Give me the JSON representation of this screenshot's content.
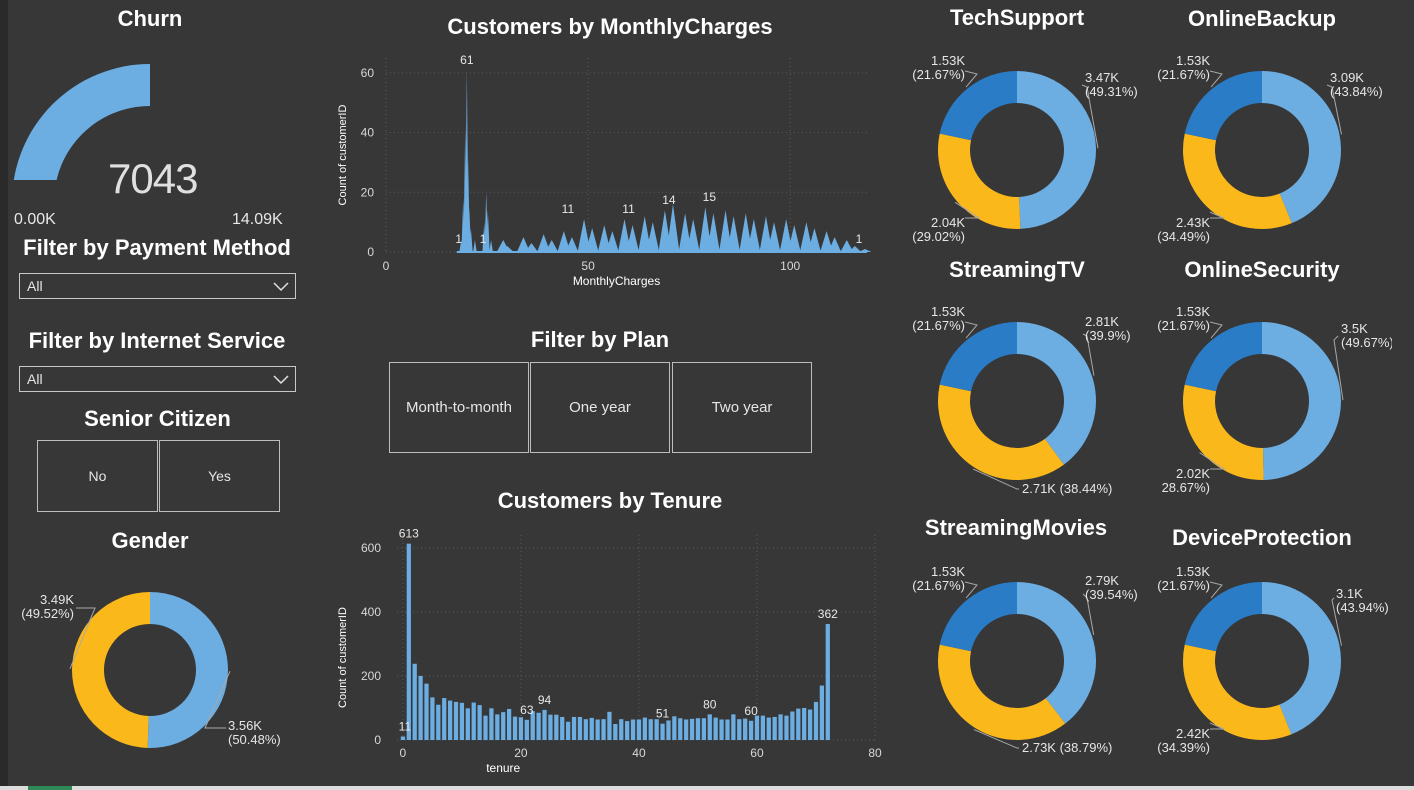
{
  "gauge": {
    "title": "Churn",
    "value_label": "7043",
    "value": 7043,
    "min_label": "0.00K",
    "max_label": "14.09K",
    "min": 0,
    "max": 14086,
    "color": "#6cade2"
  },
  "payment_filter": {
    "title": "Filter by Payment Method",
    "selected": "All"
  },
  "internet_filter": {
    "title": "Filter by Internet Service",
    "selected": "All"
  },
  "senior_filter": {
    "title": "Senior Citizen",
    "options": [
      "No",
      "Yes"
    ]
  },
  "plan_filter": {
    "title": "Filter by Plan",
    "options": [
      "Month-to-month",
      "One year",
      "Two year"
    ]
  },
  "colors": {
    "blue_light": "#6cade2",
    "blue_dark": "#2b7cc6",
    "yellow": "#fbb81b",
    "background": "#373737"
  },
  "chart_data": [
    {
      "id": "monthly",
      "type": "area",
      "title": "Customers by MonthlyCharges",
      "xlabel": "MonthlyCharges",
      "ylabel": "Count of customerID",
      "xlim": [
        0,
        119
      ],
      "ylim": [
        0,
        65
      ],
      "xticks": [
        0,
        50,
        100
      ],
      "yticks": [
        0,
        20,
        40,
        60
      ],
      "grid": true,
      "peaks": [
        {
          "x": 18.6,
          "y": 4
        },
        {
          "x": 19.1,
          "y": 18
        },
        {
          "x": 19.6,
          "y": 42
        },
        {
          "x": 20.0,
          "y": 61
        },
        {
          "x": 20.3,
          "y": 32
        },
        {
          "x": 20.6,
          "y": 15
        },
        {
          "x": 21.0,
          "y": 8
        },
        {
          "x": 22.0,
          "y": 4
        },
        {
          "x": 24.3,
          "y": 10
        },
        {
          "x": 24.8,
          "y": 20
        },
        {
          "x": 25.2,
          "y": 14
        },
        {
          "x": 26.0,
          "y": 4
        },
        {
          "x": 29,
          "y": 4
        },
        {
          "x": 30,
          "y": 2
        },
        {
          "x": 34,
          "y": 5
        },
        {
          "x": 36,
          "y": 3
        },
        {
          "x": 39,
          "y": 6
        },
        {
          "x": 41,
          "y": 4
        },
        {
          "x": 44,
          "y": 7
        },
        {
          "x": 46,
          "y": 5
        },
        {
          "x": 49,
          "y": 11
        },
        {
          "x": 51,
          "y": 8
        },
        {
          "x": 54,
          "y": 9
        },
        {
          "x": 56,
          "y": 7
        },
        {
          "x": 59,
          "y": 11
        },
        {
          "x": 61,
          "y": 9
        },
        {
          "x": 64,
          "y": 12
        },
        {
          "x": 66,
          "y": 10
        },
        {
          "x": 69,
          "y": 14
        },
        {
          "x": 71,
          "y": 16
        },
        {
          "x": 74,
          "y": 13
        },
        {
          "x": 76,
          "y": 11
        },
        {
          "x": 79,
          "y": 15
        },
        {
          "x": 81,
          "y": 13
        },
        {
          "x": 84,
          "y": 14
        },
        {
          "x": 86,
          "y": 12
        },
        {
          "x": 89,
          "y": 13
        },
        {
          "x": 91,
          "y": 11
        },
        {
          "x": 94,
          "y": 12
        },
        {
          "x": 96,
          "y": 10
        },
        {
          "x": 99,
          "y": 11
        },
        {
          "x": 101,
          "y": 9
        },
        {
          "x": 104,
          "y": 10
        },
        {
          "x": 106,
          "y": 8
        },
        {
          "x": 109,
          "y": 7
        },
        {
          "x": 111,
          "y": 5
        },
        {
          "x": 114,
          "y": 4
        },
        {
          "x": 116,
          "y": 2
        },
        {
          "x": 118.5,
          "y": 1
        }
      ],
      "data_labels": [
        {
          "x": 20,
          "y": 61,
          "text": "61"
        },
        {
          "x": 18,
          "y": 1,
          "text": "1"
        },
        {
          "x": 24,
          "y": 1,
          "text": "1"
        },
        {
          "x": 45,
          "y": 11,
          "text": "11"
        },
        {
          "x": 60,
          "y": 11,
          "text": "11"
        },
        {
          "x": 70,
          "y": 14,
          "text": "14"
        },
        {
          "x": 80,
          "y": 15,
          "text": "15"
        },
        {
          "x": 117,
          "y": 1,
          "text": "1"
        }
      ]
    },
    {
      "id": "tenure",
      "type": "bar",
      "title": "Customers by Tenure",
      "xlabel": "tenure",
      "ylabel": "Count of customerID",
      "xlim": [
        -1,
        80
      ],
      "ylim": [
        0,
        640
      ],
      "xticks": [
        0,
        20,
        40,
        60,
        80
      ],
      "yticks": [
        0,
        200,
        400,
        600
      ],
      "grid": true,
      "x": [
        0,
        1,
        2,
        3,
        4,
        5,
        6,
        7,
        8,
        9,
        10,
        11,
        12,
        13,
        14,
        15,
        16,
        17,
        18,
        19,
        20,
        21,
        22,
        23,
        24,
        25,
        26,
        27,
        28,
        29,
        30,
        31,
        32,
        33,
        34,
        35,
        36,
        37,
        38,
        39,
        40,
        41,
        42,
        43,
        44,
        45,
        46,
        47,
        48,
        49,
        50,
        51,
        52,
        53,
        54,
        55,
        56,
        57,
        58,
        59,
        60,
        61,
        62,
        63,
        64,
        65,
        66,
        67,
        68,
        69,
        70,
        71,
        72
      ],
      "values": [
        11,
        613,
        238,
        200,
        176,
        133,
        110,
        131,
        123,
        119,
        116,
        99,
        117,
        109,
        76,
        99,
        80,
        87,
        97,
        73,
        71,
        63,
        90,
        85,
        94,
        79,
        79,
        72,
        57,
        72,
        72,
        65,
        69,
        64,
        65,
        88,
        50,
        65,
        59,
        64,
        64,
        70,
        65,
        65,
        51,
        61,
        74,
        68,
        64,
        66,
        68,
        68,
        80,
        70,
        64,
        64,
        80,
        65,
        67,
        60,
        76,
        76,
        70,
        72,
        80,
        76,
        89,
        98,
        100,
        95,
        119,
        170,
        362
      ],
      "data_labels": [
        {
          "x": 0,
          "text": "11"
        },
        {
          "x": 1,
          "text": "613"
        },
        {
          "x": 21,
          "text": "63"
        },
        {
          "x": 24,
          "text": "94"
        },
        {
          "x": 44,
          "text": "51"
        },
        {
          "x": 52,
          "text": "80"
        },
        {
          "x": 59,
          "text": "60"
        },
        {
          "x": 72,
          "text": "362"
        }
      ]
    },
    {
      "id": "gender",
      "type": "pie",
      "title": "Gender",
      "slices": [
        {
          "value": 3555,
          "percent": 50.48,
          "label": "3.56K",
          "pct_label": "(50.48%)",
          "color": "#6cade2"
        },
        {
          "value": 3488,
          "percent": 49.52,
          "label": "3.49K",
          "pct_label": "(49.52%)",
          "color": "#fbb81b"
        }
      ]
    },
    {
      "id": "techsupport",
      "type": "pie",
      "title": "TechSupport",
      "slices": [
        {
          "value": 3473,
          "percent": 49.31,
          "label": "3.47K",
          "pct_label": "(49.31%)",
          "color": "#6cade2"
        },
        {
          "value": 2044,
          "percent": 29.02,
          "label": "2.04K",
          "pct_label": "(29.02%)",
          "color": "#fbb81b"
        },
        {
          "value": 1526,
          "percent": 21.67,
          "label": "1.53K",
          "pct_label": "(21.67%)",
          "color": "#2b7cc6"
        }
      ]
    },
    {
      "id": "onlinebackup",
      "type": "pie",
      "title": "OnlineBackup",
      "slices": [
        {
          "value": 3088,
          "percent": 43.84,
          "label": "3.09K",
          "pct_label": "(43.84%)",
          "color": "#6cade2"
        },
        {
          "value": 2429,
          "percent": 34.49,
          "label": "2.43K",
          "pct_label": "(34.49%)",
          "color": "#fbb81b"
        },
        {
          "value": 1526,
          "percent": 21.67,
          "label": "1.53K",
          "pct_label": "(21.67%)",
          "color": "#2b7cc6"
        }
      ]
    },
    {
      "id": "streamingtv",
      "type": "pie",
      "title": "StreamingTV",
      "slices": [
        {
          "value": 2810,
          "percent": 39.9,
          "label": "2.81K",
          "pct_label": "(39.9%)",
          "color": "#6cade2"
        },
        {
          "value": 2707,
          "percent": 38.44,
          "label": "2.71K",
          "pct_label": "(38.44%)",
          "color": "#fbb81b"
        },
        {
          "value": 1526,
          "percent": 21.67,
          "label": "1.53K",
          "pct_label": "(21.67%)",
          "color": "#2b7cc6"
        }
      ]
    },
    {
      "id": "onlinesecurity",
      "type": "pie",
      "title": "OnlineSecurity",
      "slices": [
        {
          "value": 3498,
          "percent": 49.67,
          "label": "3.5K",
          "pct_label": "(49.67%)",
          "color": "#6cade2"
        },
        {
          "value": 2019,
          "percent": 28.67,
          "label": "2.02K",
          "pct_label": "28.67%)",
          "color": "#fbb81b"
        },
        {
          "value": 1526,
          "percent": 21.67,
          "label": "1.53K",
          "pct_label": "(21.67%)",
          "color": "#2b7cc6"
        }
      ]
    },
    {
      "id": "streamingmovies",
      "type": "pie",
      "title": "StreamingMovies",
      "slices": [
        {
          "value": 2785,
          "percent": 39.54,
          "label": "2.79K",
          "pct_label": "(39.54%)",
          "color": "#6cade2"
        },
        {
          "value": 2732,
          "percent": 38.79,
          "label": "2.73K",
          "pct_label": "(38.79%)",
          "color": "#fbb81b"
        },
        {
          "value": 1526,
          "percent": 21.67,
          "label": "1.53K",
          "pct_label": "(21.67%)",
          "color": "#2b7cc6"
        }
      ]
    },
    {
      "id": "deviceprotection",
      "type": "pie",
      "title": "DeviceProtection",
      "slices": [
        {
          "value": 3095,
          "percent": 43.94,
          "label": "3.1K",
          "pct_label": "(43.94%)",
          "color": "#6cade2"
        },
        {
          "value": 2422,
          "percent": 34.39,
          "label": "2.42K",
          "pct_label": "(34.39%)",
          "color": "#fbb81b"
        },
        {
          "value": 1526,
          "percent": 21.67,
          "label": "1.53K",
          "pct_label": "(21.67%)",
          "color": "#2b7cc6"
        }
      ]
    }
  ]
}
